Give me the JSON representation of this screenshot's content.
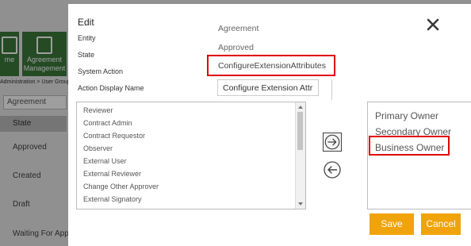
{
  "background": {
    "tiles": [
      {
        "label": "me"
      },
      {
        "label": "Agreement Management"
      }
    ],
    "breadcrumb": "Administration > User Group",
    "select_value": "Agreement",
    "column_header": "State",
    "rows": [
      "Approved",
      "Created",
      "Draft",
      "Waiting For Appr"
    ]
  },
  "dialog": {
    "title": "Edit",
    "labels": {
      "entity": "Entity",
      "state": "State",
      "system_action": "System Action",
      "action_display_name": "Action Display Name"
    },
    "values": {
      "entity": "Agreement",
      "state": "Approved",
      "system_action": "ConfigureExtensionAttributes",
      "action_display_name": "Configure Extension Attrib"
    },
    "available_list": [
      "Reviewer",
      "Contract Admin",
      "Contract Requestor",
      "Observer",
      "External User",
      "External Reviewer",
      "Change Other Approver",
      "External Signatory"
    ],
    "selected_list": [
      "Primary Owner",
      "Secondary Owner",
      "Business Owner"
    ],
    "buttons": {
      "save": "Save",
      "cancel": "Cancel"
    },
    "icons": {
      "close": "close-icon",
      "move_right": "arrow-right-circle-icon",
      "move_left": "arrow-left-circle-icon"
    }
  },
  "colors": {
    "accent": "#f0a30a",
    "highlight": "#e00000",
    "bg_tile": "#3c7a3c"
  }
}
